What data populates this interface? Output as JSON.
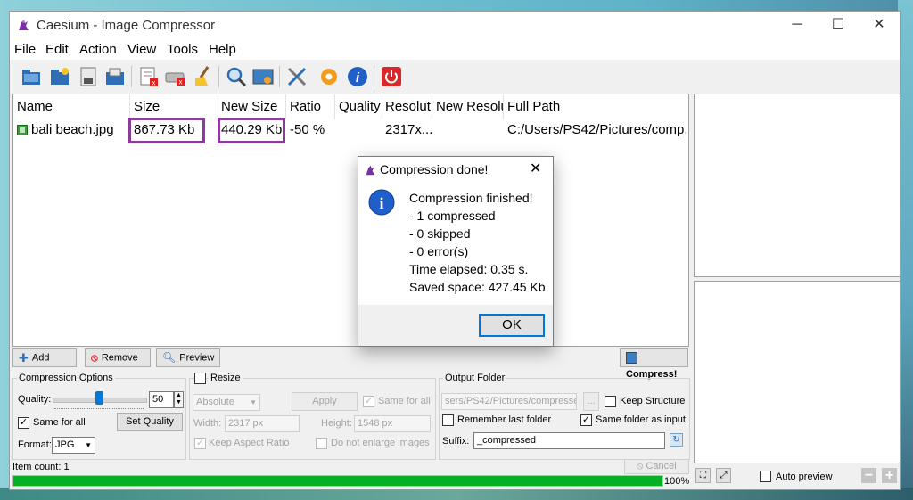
{
  "window": {
    "title": "Caesium - Image Compressor"
  },
  "menu": [
    "File",
    "Edit",
    "Action",
    "View",
    "Tools",
    "Help"
  ],
  "toolbar": {
    "icons": [
      "open-folder-icon",
      "add-folder-icon",
      "save-icon",
      "export-icon",
      "clear-list-icon",
      "remove-item-icon",
      "broom-icon",
      "search-icon",
      "image-preview-icon",
      "tools-icon",
      "settings-icon",
      "info-icon",
      "power-icon"
    ]
  },
  "list": {
    "columns": [
      "Name",
      "Size",
      "New Size",
      "Ratio",
      "Quality",
      "Resolut",
      "New Resolu",
      "Full Path"
    ],
    "rows": [
      {
        "name": "bali beach.jpg",
        "size": "867.73 Kb",
        "new_size": "440.29 Kb",
        "ratio": "-50 %",
        "quality": "",
        "resolution": "2317x...",
        "new_resolution": "",
        "full_path": "C:/Users/PS42/Pictures/comp..."
      }
    ]
  },
  "buttons": {
    "add": "Add",
    "remove": "Remove",
    "preview": "Preview",
    "compress": "Compress!"
  },
  "compression": {
    "group_title": "Compression Options",
    "quality_label": "Quality:",
    "quality_value": "50",
    "quality_level": 0.5,
    "same_for_all": "Same for all",
    "set_quality": "Set Quality",
    "format_label": "Format:",
    "format_value": "JPG"
  },
  "resize": {
    "group_title": "Resize",
    "mode": "Absolute",
    "apply": "Apply",
    "same_for_all": "Same for all",
    "width_label": "Width:",
    "width_value": "2317 px",
    "height_label": "Height:",
    "height_value": "1548 px",
    "keep_aspect": "Keep Aspect Ratio",
    "no_enlarge": "Do not enlarge images"
  },
  "output": {
    "group_title": "Output Folder",
    "path": "sers/PS42/Pictures/compressed",
    "browse": "...",
    "keep_structure": "Keep Structure",
    "remember_last": "Remember last folder",
    "same_as_input": "Same folder as input",
    "suffix_label": "Suffix:",
    "suffix_value": "_compressed"
  },
  "status": {
    "item_count": "Item count: 1",
    "cancel": "Cancel",
    "progress_label": "100%",
    "progress_value": 1.0,
    "auto_preview": "Auto preview"
  },
  "dialog": {
    "title": "Compression done!",
    "lines": [
      "Compression finished!",
      "- 1 compressed",
      "- 0 skipped",
      "- 0 error(s)",
      "Time elapsed: 0.35 s.",
      "Saved space: 427.45 Kb"
    ],
    "ok": "OK"
  },
  "colors": {
    "highlight": "#8b3c99",
    "progress": "#06b025",
    "accent": "#0078d7"
  }
}
